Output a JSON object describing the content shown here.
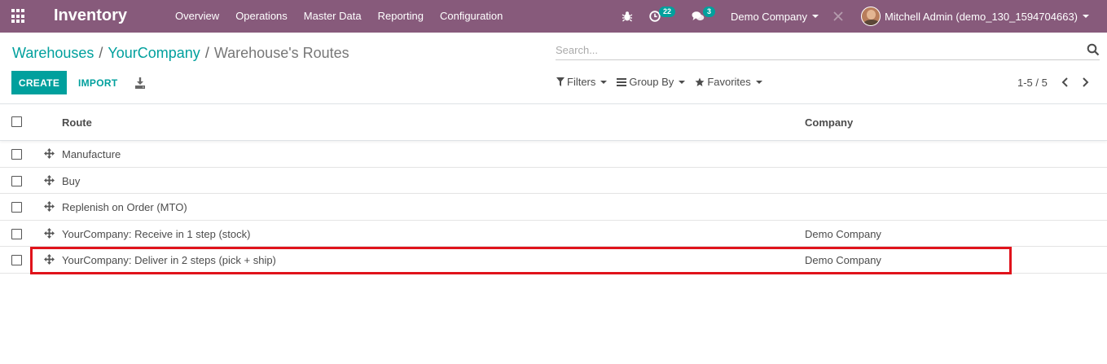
{
  "navbar": {
    "app_title": "Inventory",
    "menu": [
      "Overview",
      "Operations",
      "Master Data",
      "Reporting",
      "Configuration"
    ],
    "activity_count": "22",
    "message_count": "3",
    "company": "Demo Company",
    "user": "Mitchell Admin (demo_130_1594704663)"
  },
  "breadcrumb": {
    "items": [
      "Warehouses",
      "YourCompany"
    ],
    "current": "Warehouse's Routes"
  },
  "search": {
    "placeholder": "Search..."
  },
  "buttons": {
    "create": "CREATE",
    "import": "IMPORT"
  },
  "filters": {
    "filters": "Filters",
    "group_by": "Group By",
    "favorites": "Favorites"
  },
  "pager": {
    "value": "1-5 / 5"
  },
  "table": {
    "columns": [
      "Route",
      "Company"
    ],
    "rows": [
      {
        "route": "Manufacture",
        "company": ""
      },
      {
        "route": "Buy",
        "company": ""
      },
      {
        "route": "Replenish on Order (MTO)",
        "company": ""
      },
      {
        "route": "YourCompany: Receive in 1 step (stock)",
        "company": "Demo Company"
      },
      {
        "route": "YourCompany: Deliver in 2 steps (pick + ship)",
        "company": "Demo Company"
      }
    ]
  },
  "colors": {
    "navbar": "#875a7b",
    "primary": "#00a09d",
    "highlight": "#e0131b"
  },
  "icons": [
    "apps-grid-icon",
    "bug-icon",
    "clock-icon",
    "chat-icon",
    "close-icon",
    "search-icon",
    "download-icon",
    "filter-icon",
    "list-icon",
    "star-icon",
    "chevron-left-icon",
    "chevron-right-icon",
    "drag-handle-icon"
  ]
}
